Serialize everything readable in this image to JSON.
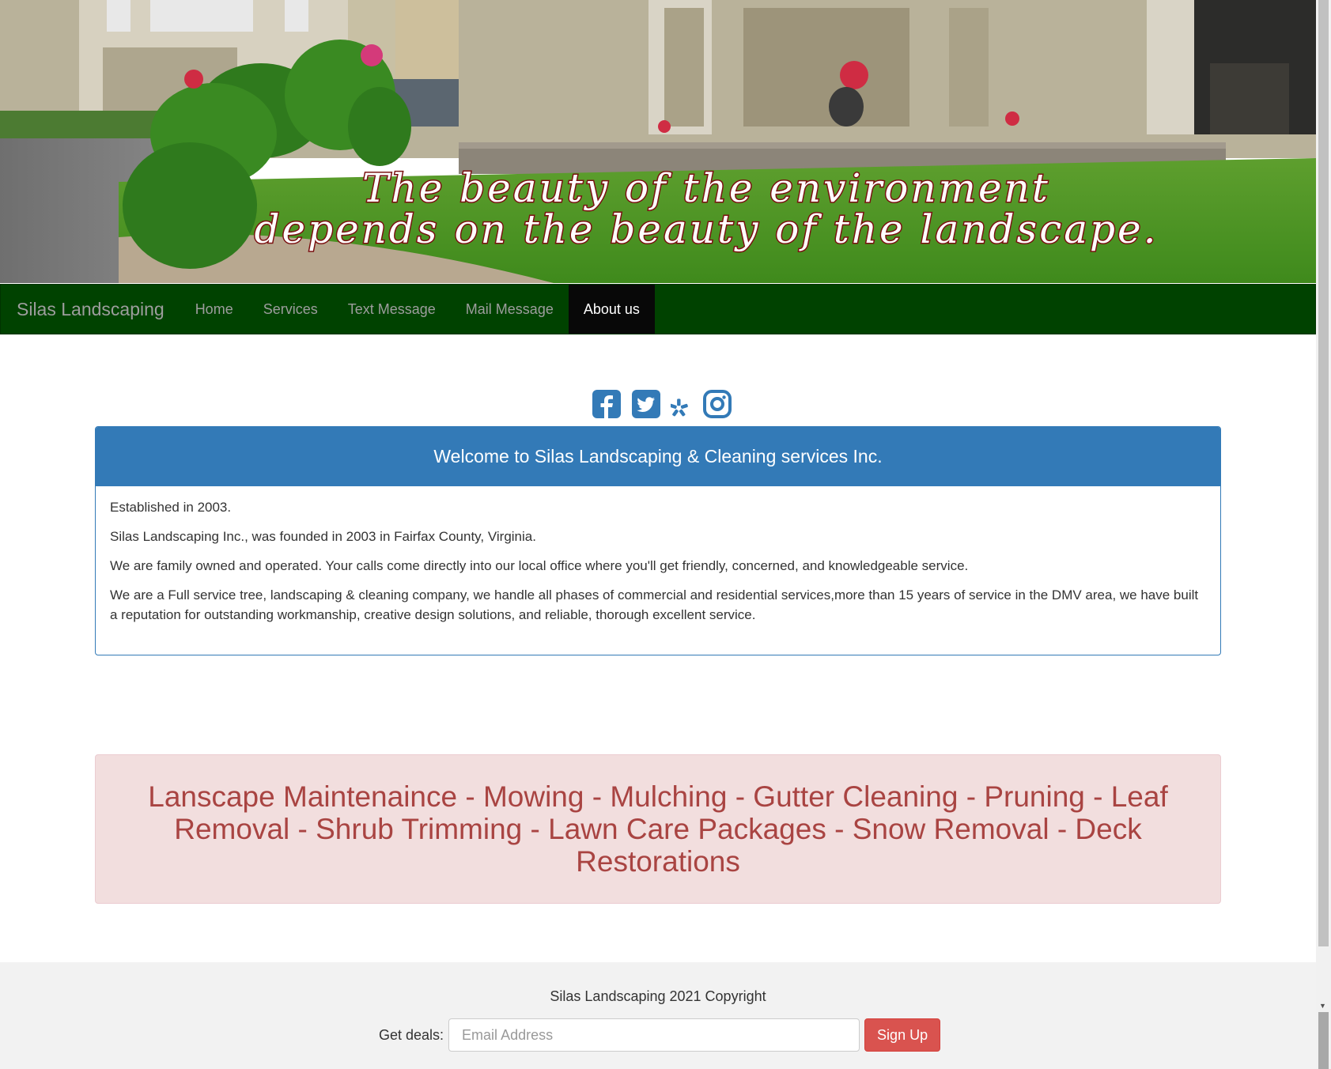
{
  "hero": {
    "tagline_line1": "The beauty of the environment",
    "tagline_line2": "depends on the beauty of the landscape."
  },
  "navbar": {
    "brand": "Silas Landscaping",
    "links": [
      {
        "label": "Home"
      },
      {
        "label": "Services"
      },
      {
        "label": "Text Message"
      },
      {
        "label": "Mail Message"
      },
      {
        "label": "About us",
        "active": true
      }
    ],
    "bg_color": "#004200",
    "active_bg": "#080808"
  },
  "social": [
    "facebook-icon",
    "twitter-icon",
    "yelp-icon",
    "instagram-icon"
  ],
  "welcome": {
    "heading": "Welcome to Silas Landscaping & Cleaning services Inc.",
    "paragraphs": [
      "Established in 2003.",
      "Silas Landscaping Inc., was founded in 2003 in Fairfax County, Virginia.",
      "We are family owned and operated. Your calls come directly into our local office where you'll get friendly, concerned, and knowledgeable service.",
      "We are a Full service tree, landscaping & cleaning company, we handle all phases of commercial and residential services,more than 15 years of service in the DMV area, we have built a reputation for outstanding workmanship, creative design solutions, and reliable, thorough excellent service."
    ],
    "accent_color": "#337ab7"
  },
  "services_banner": {
    "text": "Lanscape Maintenaince - Mowing - Mulching - Gutter Cleaning - Pruning - Leaf Removal - Shrub Trimming - Lawn Care Packages - Snow Removal - Deck Restorations",
    "text_color": "#a94442",
    "bg_color": "#f2dede"
  },
  "footer": {
    "copyright": "Silas Landscaping 2021 Copyright",
    "deals_label": "Get deals:",
    "email_placeholder": "Email Address",
    "signup_label": "Sign Up",
    "signup_color": "#d9534f"
  }
}
